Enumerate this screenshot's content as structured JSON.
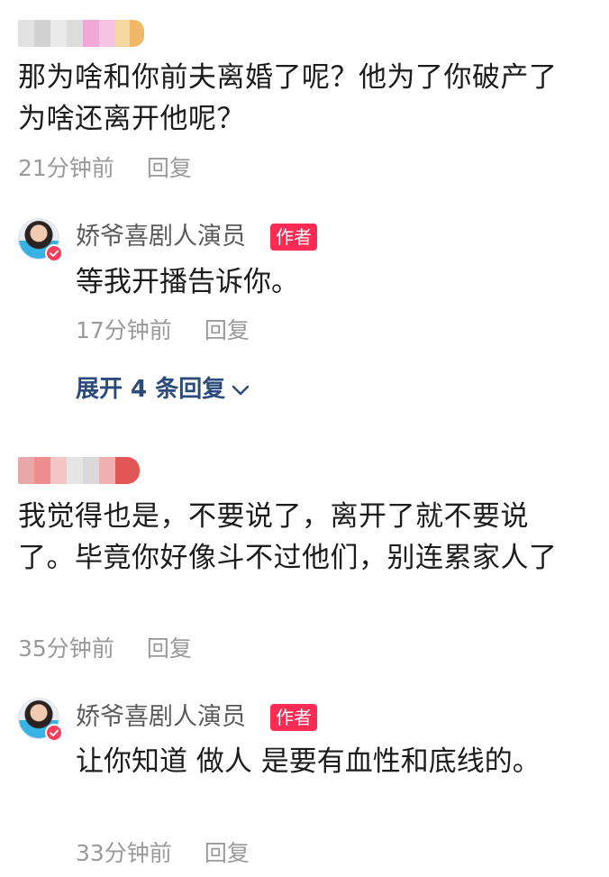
{
  "comments": [
    {
      "text": "那为啥和你前夫离婚了呢？他为了你破产了为啥还离开他呢？",
      "time": "21分钟前",
      "reply_label": "回复",
      "author_reply": {
        "name": "娇爷喜剧人演员",
        "tag": "作者",
        "text": "等我开播告诉你。",
        "time": "17分钟前",
        "reply_label": "回复"
      },
      "expand_label": "展开 4 条回复"
    },
    {
      "text": "我觉得也是，不要说了，离开了就不要说了。毕竟你好像斗不过他们，别连累家人了",
      "time": "35分钟前",
      "reply_label": "回复",
      "author_reply": {
        "name": "娇爷喜剧人演员",
        "tag": "作者",
        "text": "让你知道 做人 是要有血性和底线的。",
        "time": "33分钟前",
        "reply_label": "回复"
      }
    }
  ],
  "colors": {
    "author_tag_bg": "#fe2c55",
    "expand_link": "#2b4b7a",
    "meta_text": "#9a9a9a"
  },
  "icons": {
    "expand": "chevron-down-icon",
    "verified": "check-badge-icon"
  }
}
